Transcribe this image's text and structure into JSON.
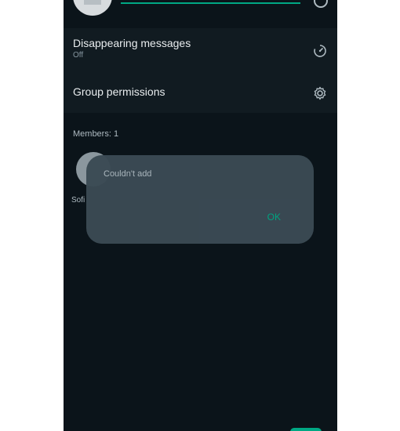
{
  "settings": {
    "disappearing": {
      "title": "Disappearing messages",
      "value": "Off",
      "icon": "timer-icon"
    },
    "permissions": {
      "title": "Group permissions",
      "icon": "gear-icon"
    }
  },
  "members": {
    "label": "Members: 1",
    "list": [
      {
        "name": "Sofi"
      }
    ]
  },
  "dialog": {
    "message": "Couldn't add",
    "ok_label": "OK"
  },
  "colors": {
    "accent": "#00a884",
    "background": "#0b141a",
    "section": "#111b21",
    "dialog": "#3b4a54"
  }
}
